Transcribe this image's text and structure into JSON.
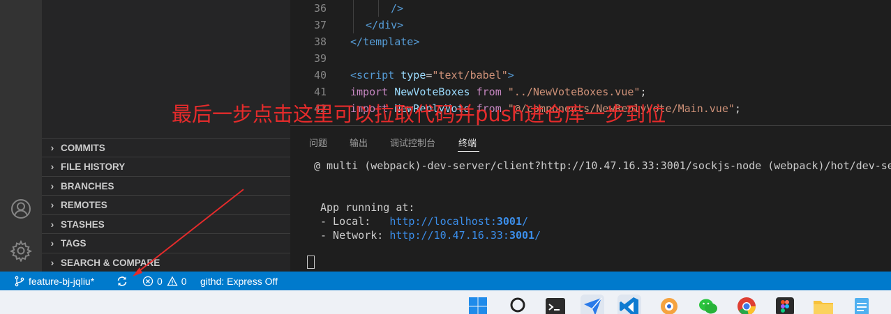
{
  "editor": {
    "lines": [
      {
        "num": "36",
        "parts": [
          {
            "t": "/>",
            "c": "tag"
          }
        ]
      },
      {
        "num": "37",
        "parts": [
          {
            "t": "</",
            "c": "tag"
          },
          {
            "t": "div",
            "c": "tag"
          },
          {
            "t": ">",
            "c": "tag"
          }
        ]
      },
      {
        "num": "38",
        "parts": [
          {
            "t": "</",
            "c": "tag"
          },
          {
            "t": "template",
            "c": "tag"
          },
          {
            "t": ">",
            "c": "tag"
          }
        ]
      },
      {
        "num": "39",
        "parts": []
      },
      {
        "num": "40",
        "parts": [
          {
            "t": "<",
            "c": "tag"
          },
          {
            "t": "script",
            "c": "tag"
          },
          {
            "t": " ",
            "c": ""
          },
          {
            "t": "type",
            "c": "attr"
          },
          {
            "t": "=",
            "c": ""
          },
          {
            "t": "\"text/babel\"",
            "c": "str"
          },
          {
            "t": ">",
            "c": "tag"
          }
        ]
      },
      {
        "num": "41",
        "parts": [
          {
            "t": "import",
            "c": "kw"
          },
          {
            "t": " ",
            "c": ""
          },
          {
            "t": "NewVoteBoxes",
            "c": "id"
          },
          {
            "t": " ",
            "c": ""
          },
          {
            "t": "from",
            "c": "kw"
          },
          {
            "t": " ",
            "c": ""
          },
          {
            "t": "\"../NewVoteBoxes.vue\"",
            "c": "str"
          },
          {
            "t": ";",
            "c": ""
          }
        ]
      },
      {
        "num": "42",
        "parts": [
          {
            "t": "import",
            "c": "kw"
          },
          {
            "t": " ",
            "c": ""
          },
          {
            "t": "NewReplyVote",
            "c": "id"
          },
          {
            "t": " ",
            "c": ""
          },
          {
            "t": "from",
            "c": "kw"
          },
          {
            "t": " ",
            "c": ""
          },
          {
            "t": "\"@/components/NewReplyVote/Main.vue\"",
            "c": "str"
          },
          {
            "t": ";",
            "c": ""
          }
        ]
      }
    ]
  },
  "sidebar": {
    "sections": [
      {
        "label": "COMMITS"
      },
      {
        "label": "FILE HISTORY"
      },
      {
        "label": "BRANCHES"
      },
      {
        "label": "REMOTES"
      },
      {
        "label": "STASHES"
      },
      {
        "label": "TAGS"
      },
      {
        "label": "SEARCH & COMPARE"
      }
    ]
  },
  "panel": {
    "tabs": [
      "问题",
      "输出",
      "调试控制台",
      "终端"
    ],
    "active_tab": "终端",
    "terminal": {
      "line1": "@ multi (webpack)-dev-server/client?http://10.47.16.33:3001/sockjs-node (webpack)/hot/dev-se",
      "app_running": "App running at:",
      "local_label": "- Local:   ",
      "local_url": "http://localhost:",
      "local_port": "3001",
      "local_tail": "/",
      "network_label": "- Network: ",
      "network_url": "http://10.47.16.33:",
      "network_port": "3001",
      "network_tail": "/"
    }
  },
  "statusbar": {
    "branch": "feature-bj-jqliu*",
    "errors": "0",
    "warnings": "0",
    "githd": "githd: Express Off",
    "color": "#007acc"
  },
  "annotation": {
    "text": "最后一步点击这里可以拉取代码并push进仓库一步到位",
    "color": "#e52b2b"
  },
  "taskbar": {
    "icons": [
      "windows-start-icon",
      "search-icon",
      "terminal-icon",
      "feishu-icon",
      "vscode-icon",
      "app-icon",
      "wechat-icon",
      "chrome-icon",
      "figma-icon",
      "folder-icon",
      "notepad-icon"
    ]
  }
}
